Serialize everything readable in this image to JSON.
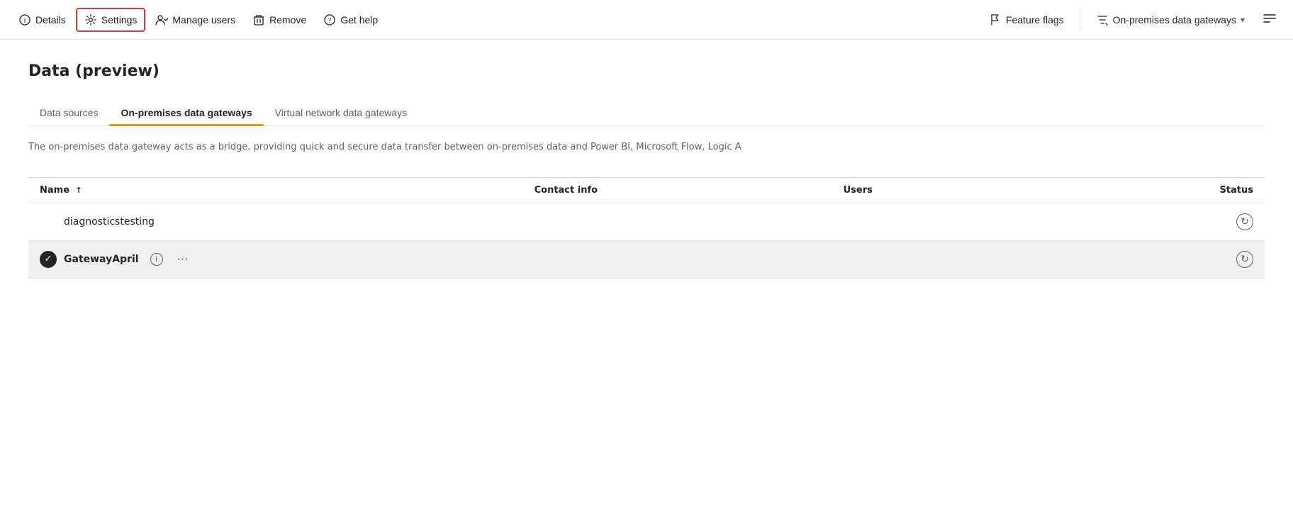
{
  "toolbar": {
    "items": [
      {
        "id": "details",
        "label": "Details",
        "icon": "ℹ"
      },
      {
        "id": "settings",
        "label": "Settings",
        "icon": "⚙",
        "active_outline": true
      },
      {
        "id": "manage-users",
        "label": "Manage users",
        "icon": "👥"
      },
      {
        "id": "remove",
        "label": "Remove",
        "icon": "🗑"
      },
      {
        "id": "get-help",
        "label": "Get help",
        "icon": "?"
      }
    ],
    "right_items": [
      {
        "id": "feature-flags",
        "label": "Feature flags",
        "icon": "⚑"
      },
      {
        "id": "on-premises-gateways",
        "label": "On-premises data gateways",
        "icon": "filter",
        "has_dropdown": true
      }
    ]
  },
  "page": {
    "title": "Data (preview)",
    "description": "The on-premises data gateway acts as a bridge, providing quick and secure data transfer between on-premises data and Power BI, Microsoft Flow, Logic A"
  },
  "tabs": [
    {
      "id": "data-sources",
      "label": "Data sources",
      "active": false
    },
    {
      "id": "on-premises",
      "label": "On-premises data gateways",
      "active": true
    },
    {
      "id": "virtual-network",
      "label": "Virtual network data gateways",
      "active": false
    }
  ],
  "table": {
    "columns": [
      {
        "id": "name",
        "label": "Name",
        "sort": "↑"
      },
      {
        "id": "contact",
        "label": "Contact info"
      },
      {
        "id": "users",
        "label": "Users"
      },
      {
        "id": "status",
        "label": "Status"
      }
    ],
    "rows": [
      {
        "id": "row1",
        "selected": false,
        "check": false,
        "name": "diagnosticstesting",
        "contact": "",
        "users": "",
        "status_icon": "↻"
      },
      {
        "id": "row2",
        "selected": true,
        "check": true,
        "name": "GatewayApril",
        "has_info": true,
        "has_ellipsis": true,
        "contact": "",
        "users": "",
        "status_icon": "↻"
      }
    ]
  }
}
